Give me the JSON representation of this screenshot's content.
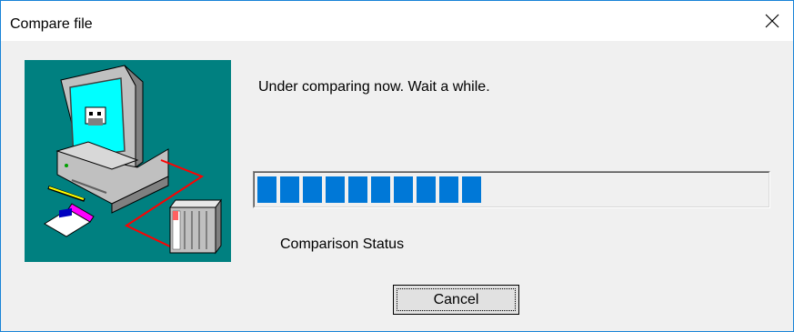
{
  "window": {
    "title": "Compare file",
    "close_icon": "close-icon",
    "accent_color": "#1883d7"
  },
  "illustration": {
    "icon": "computer-plc-comparison-icon",
    "background_color": "#008080"
  },
  "message": "Under comparing now. Wait a while.",
  "progress": {
    "filled_blocks": 10,
    "fraction": 0.45,
    "color": "#0078d7"
  },
  "status_label": "Comparison Status",
  "buttons": {
    "cancel": "Cancel"
  }
}
